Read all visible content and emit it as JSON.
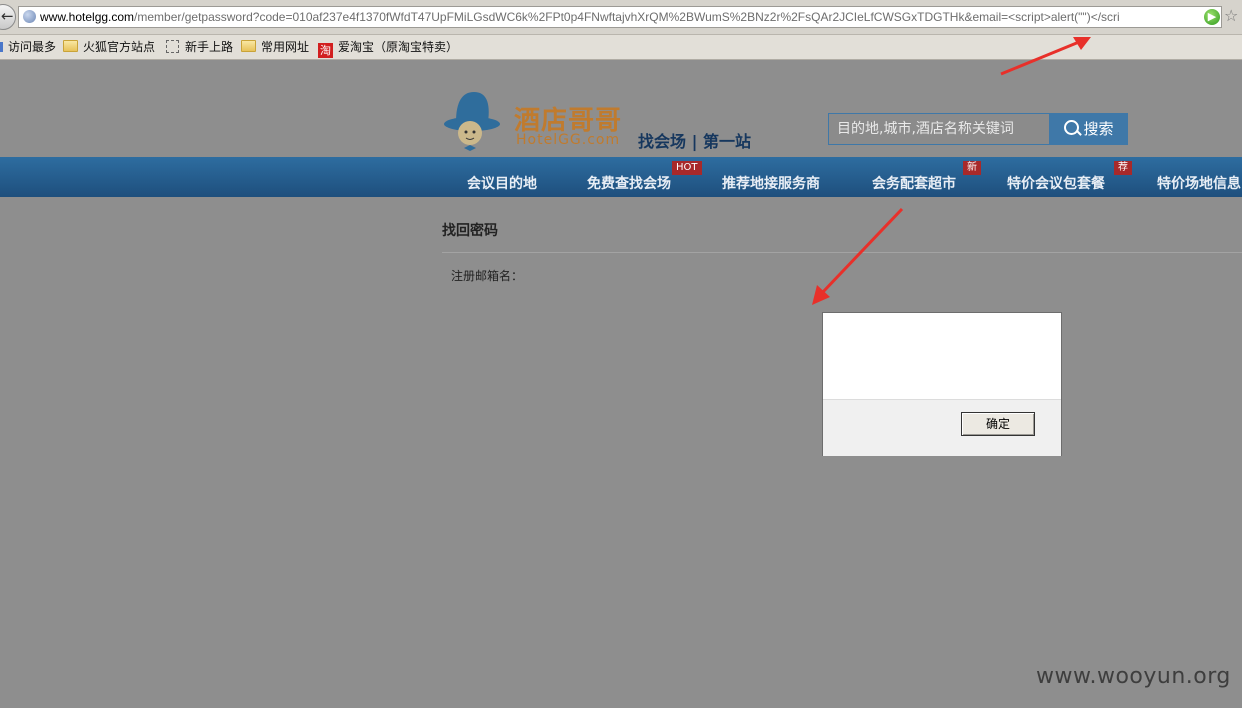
{
  "browser": {
    "url_host": "www.hotelgg.com",
    "url_path": "/member/getpassword?code=010af237e4f1370fWfdT47UpFMiLGsdWC6k%2FPt0p4FNwftajvhXrQM%2BWumS%2BNz2r%2FsQAr2JCIeLfCWSGxTDGTHk&email=<script>alert(\"\")</scri",
    "bookmarks": [
      "访问最多",
      "火狐官方站点",
      "新手上路",
      "常用网址",
      "爱淘宝（原淘宝特卖）"
    ],
    "icons": [
      "back-arrow-icon",
      "globe-icon",
      "go-icon",
      "star-icon",
      "folder-icon",
      "taobao-icon"
    ]
  },
  "site": {
    "logo_cn": "酒店哥哥",
    "logo_en": "HotelGG.com",
    "slogan": "找会场 | 第一站",
    "search_placeholder": "目的地,城市,酒店名称关键词",
    "search_button": "搜索",
    "nav": [
      {
        "label": "会议目的地",
        "badge": ""
      },
      {
        "label": "免费查找会场",
        "badge": "HOT"
      },
      {
        "label": "推荐地接服务商",
        "badge": ""
      },
      {
        "label": "会务配套超市",
        "badge": "新"
      },
      {
        "label": "特价会议包套餐",
        "badge": "荐"
      },
      {
        "label": "特价场地信息",
        "badge": ""
      }
    ],
    "brand_blue": "#3f78a8",
    "brand_orange": "#c07b2e"
  },
  "main": {
    "title": "找回密码",
    "email_label": "注册邮箱名："
  },
  "dialog": {
    "ok_button": "确定"
  },
  "watermark": "www.wooyun.org"
}
